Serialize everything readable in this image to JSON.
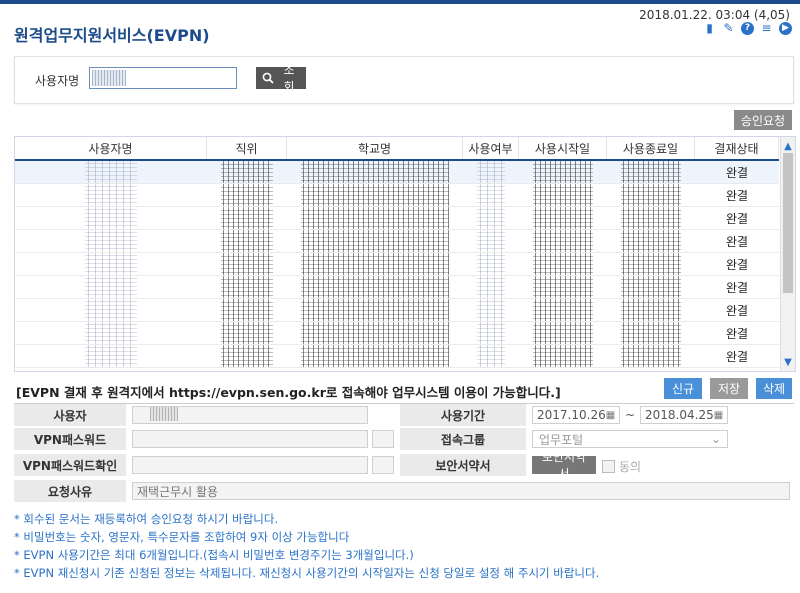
{
  "header": {
    "title": "원격업무지원서비스(EVPN)",
    "datetime": "2018.01.22. 03:04 (4,05)",
    "icons": [
      "chat-icon",
      "edit-icon",
      "help-icon",
      "list-icon",
      "play-icon"
    ]
  },
  "search": {
    "label": "사용자명",
    "value": "",
    "button": "조회"
  },
  "toolbar": {
    "approve_request": "승인요청"
  },
  "grid": {
    "columns": [
      "사용자명",
      "직위",
      "학교명",
      "사용여부",
      "사용시작일",
      "사용종료일",
      "결재상태"
    ],
    "rows": [
      {
        "status": "완결"
      },
      {
        "status": "완결"
      },
      {
        "status": "완결"
      },
      {
        "status": "완결"
      },
      {
        "status": "완결"
      },
      {
        "status": "완결"
      },
      {
        "status": "완결"
      },
      {
        "status": "완결"
      },
      {
        "status": "완결"
      }
    ]
  },
  "notice": "[EVPN 결재 후 원격지에서 https://evpn.sen.go.kr로 접속해야 업무시스템 이용이 가능합니다.]",
  "actions": {
    "new": "신규",
    "save": "저장",
    "delete": "삭제"
  },
  "form": {
    "user_label": "사용자",
    "period_label": "사용기간",
    "start_date": "2017.10.26",
    "end_date": "2018.04.25",
    "tilde": "~",
    "vpn_pw_label": "VPN패스워드",
    "group_label": "접속그룹",
    "group_value": "업무포털",
    "vpn_pw_confirm_label": "VPN패스워드확인",
    "security_label": "보안서약서",
    "security_button": "보안서약서",
    "agree_label": "동의",
    "reason_label": "요청사유",
    "reason_value": "재택근무시 활용"
  },
  "notes": [
    "* 회수된 문서는 재등록하여 승인요청 하시기 바랍니다.",
    "* 비밀번호는 숫자, 영문자, 특수문자를 조합하여 9자 이상 가능합니다",
    "* EVPN 사용기간은 최대 6개월입니다.(접속시 비밀번호 변경주기는 3개월입니다.)",
    "* EVPN 재신청시 기존 신청된 정보는 삭제됩니다. 재신청시 사용기간의 시작일자는 신청 당일로 설정 해 주시기 바랍니다."
  ]
}
